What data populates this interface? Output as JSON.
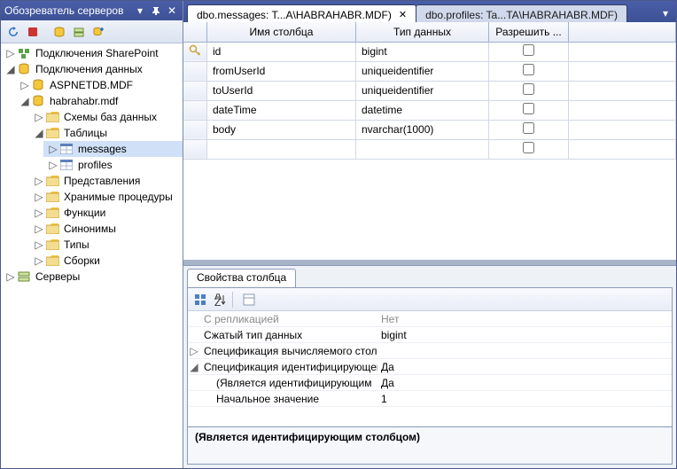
{
  "left": {
    "title": "Обозреватель серверов",
    "tree": {
      "sharepoint": "Подключения SharePoint",
      "data_conns": "Подключения данных",
      "aspnetdb": "ASPNETDB.MDF",
      "habradb": "habrahabr.mdf",
      "schemas": "Схемы баз данных",
      "tables": "Таблицы",
      "tbl_messages": "messages",
      "tbl_profiles": "profiles",
      "views": "Представления",
      "sprocs": "Хранимые процедуры",
      "functions": "Функции",
      "synonyms": "Синонимы",
      "types": "Типы",
      "assemblies": "Сборки",
      "servers": "Серверы"
    }
  },
  "tabs": {
    "active": "dbo.messages: T...A\\HABRAHABR.MDF)",
    "inactive": "dbo.profiles: Ta...TA\\HABRAHABR.MDF)"
  },
  "grid": {
    "col_name": "Имя столбца",
    "col_type": "Тип данных",
    "col_null": "Разрешить ...",
    "rows": [
      {
        "name": "id",
        "type": "bigint",
        "nullable": false
      },
      {
        "name": "fromUserId",
        "type": "uniqueidentifier",
        "nullable": false
      },
      {
        "name": "toUserId",
        "type": "uniqueidentifier",
        "nullable": false
      },
      {
        "name": "dateTime",
        "type": "datetime",
        "nullable": false
      },
      {
        "name": "body",
        "type": "nvarchar(1000)",
        "nullable": false
      }
    ]
  },
  "props": {
    "tab": "Свойства столбца",
    "rows": {
      "replication_n": "С репликацией",
      "replication_v": "Нет",
      "condensed_n": "Сжатый тип данных",
      "condensed_v": "bigint",
      "computed_n": "Спецификация вычисляемого столбца",
      "identity_n": "Спецификация идентифицирующего",
      "identity_v": "Да",
      "is_ident_n": "(Является идентифицирующим",
      "is_ident_v": "Да",
      "seed_n": "Начальное значение",
      "seed_v": "1"
    },
    "desc": "(Является идентифицирующим столбцом)"
  }
}
